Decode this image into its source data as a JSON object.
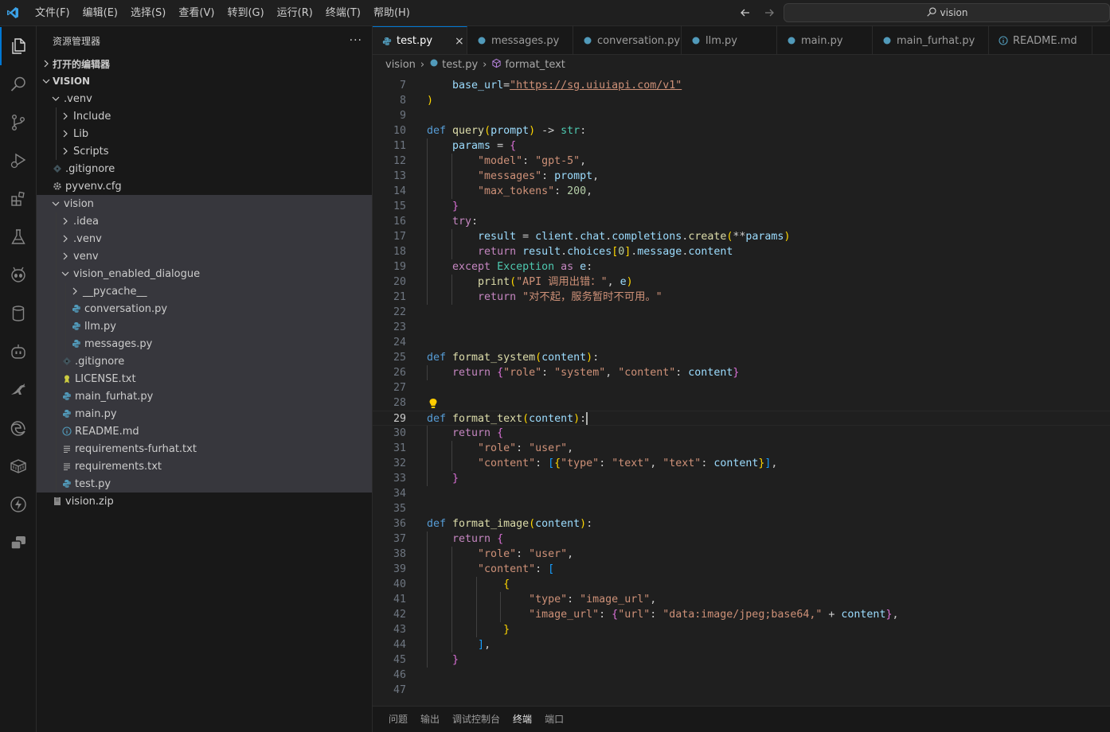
{
  "titlebar": {
    "menu": [
      "文件(F)",
      "编辑(E)",
      "选择(S)",
      "查看(V)",
      "转到(G)",
      "运行(R)",
      "终端(T)",
      "帮助(H)"
    ],
    "search_text": "vision"
  },
  "sidebar": {
    "title": "资源管理器",
    "more": "···",
    "open_editors": "打开的编辑器",
    "root": "VISION",
    "tree": [
      {
        "label": ".venv"
      },
      {
        "label": "Include"
      },
      {
        "label": "Lib"
      },
      {
        "label": "Scripts"
      },
      {
        "label": ".gitignore"
      },
      {
        "label": "pyvenv.cfg"
      },
      {
        "label": "vision"
      },
      {
        "label": ".idea"
      },
      {
        "label": ".venv"
      },
      {
        "label": "venv"
      },
      {
        "label": "vision_enabled_dialogue"
      },
      {
        "label": "__pycache__"
      },
      {
        "label": "conversation.py"
      },
      {
        "label": "llm.py"
      },
      {
        "label": "messages.py"
      },
      {
        "label": ".gitignore"
      },
      {
        "label": "LICENSE.txt"
      },
      {
        "label": "main_furhat.py"
      },
      {
        "label": "main.py"
      },
      {
        "label": "README.md"
      },
      {
        "label": "requirements-furhat.txt"
      },
      {
        "label": "requirements.txt"
      },
      {
        "label": "test.py"
      },
      {
        "label": "vision.zip"
      }
    ]
  },
  "tabs": [
    {
      "label": "test.py",
      "close": "×"
    },
    {
      "label": "messages.py"
    },
    {
      "label": "conversation.py"
    },
    {
      "label": "llm.py"
    },
    {
      "label": "main.py"
    },
    {
      "label": "main_furhat.py"
    },
    {
      "label": "README.md"
    }
  ],
  "breadcrumb": [
    "vision",
    "test.py",
    "format_text"
  ],
  "editor": {
    "lines": [
      {
        "n": "7",
        "tokens": [
          [
            "p",
            "    "
          ],
          [
            "v",
            "base_url"
          ],
          [
            "p",
            "="
          ],
          [
            "url",
            "\"https://sg.uiuiapi.com/v1\""
          ]
        ]
      },
      {
        "n": "8",
        "tokens": [
          [
            "b1",
            ")"
          ]
        ]
      },
      {
        "n": "9",
        "tokens": []
      },
      {
        "n": "10",
        "tokens": [
          [
            "k",
            "def "
          ],
          [
            "fn",
            "query"
          ],
          [
            "b1",
            "("
          ],
          [
            "v",
            "prompt"
          ],
          [
            "b1",
            ")"
          ],
          [
            "p",
            " -> "
          ],
          [
            "t",
            "str"
          ],
          [
            "p",
            ":"
          ]
        ]
      },
      {
        "n": "11",
        "tokens": [
          [
            "p",
            "    "
          ],
          [
            "v",
            "params"
          ],
          [
            "p",
            " = "
          ],
          [
            "b2",
            "{"
          ]
        ]
      },
      {
        "n": "12",
        "tokens": [
          [
            "p",
            "        "
          ],
          [
            "s",
            "\"model\""
          ],
          [
            "p",
            ": "
          ],
          [
            "s",
            "\"gpt-5\""
          ],
          [
            "p",
            ","
          ]
        ]
      },
      {
        "n": "13",
        "tokens": [
          [
            "p",
            "        "
          ],
          [
            "s",
            "\"messages\""
          ],
          [
            "p",
            ": "
          ],
          [
            "v",
            "prompt"
          ],
          [
            "p",
            ","
          ]
        ]
      },
      {
        "n": "14",
        "tokens": [
          [
            "p",
            "        "
          ],
          [
            "s",
            "\"max_tokens\""
          ],
          [
            "p",
            ": "
          ],
          [
            "n",
            "200"
          ],
          [
            "p",
            ","
          ]
        ]
      },
      {
        "n": "15",
        "tokens": [
          [
            "p",
            "    "
          ],
          [
            "b2",
            "}"
          ]
        ]
      },
      {
        "n": "16",
        "tokens": [
          [
            "p",
            "    "
          ],
          [
            "c",
            "try"
          ],
          [
            "p",
            ":"
          ]
        ]
      },
      {
        "n": "17",
        "tokens": [
          [
            "p",
            "        "
          ],
          [
            "v",
            "result"
          ],
          [
            "p",
            " = "
          ],
          [
            "v",
            "client"
          ],
          [
            "p",
            "."
          ],
          [
            "v",
            "chat"
          ],
          [
            "p",
            "."
          ],
          [
            "v",
            "completions"
          ],
          [
            "p",
            "."
          ],
          [
            "fn",
            "create"
          ],
          [
            "b1",
            "("
          ],
          [
            "p",
            "**"
          ],
          [
            "v",
            "params"
          ],
          [
            "b1",
            ")"
          ]
        ]
      },
      {
        "n": "18",
        "tokens": [
          [
            "p",
            "        "
          ],
          [
            "c",
            "return "
          ],
          [
            "v",
            "result"
          ],
          [
            "p",
            "."
          ],
          [
            "v",
            "choices"
          ],
          [
            "b1",
            "["
          ],
          [
            "n",
            "0"
          ],
          [
            "b1",
            "]"
          ],
          [
            "p",
            "."
          ],
          [
            "v",
            "message"
          ],
          [
            "p",
            "."
          ],
          [
            "v",
            "content"
          ]
        ]
      },
      {
        "n": "19",
        "tokens": [
          [
            "p",
            "    "
          ],
          [
            "c",
            "except "
          ],
          [
            "t",
            "Exception"
          ],
          [
            "c",
            " as "
          ],
          [
            "v",
            "e"
          ],
          [
            "p",
            ":"
          ]
        ]
      },
      {
        "n": "20",
        "tokens": [
          [
            "p",
            "        "
          ],
          [
            "fn",
            "print"
          ],
          [
            "b1",
            "("
          ],
          [
            "s",
            "\"API 调用出错：\""
          ],
          [
            "p",
            ", "
          ],
          [
            "v",
            "e"
          ],
          [
            "b1",
            ")"
          ]
        ]
      },
      {
        "n": "21",
        "tokens": [
          [
            "p",
            "        "
          ],
          [
            "c",
            "return "
          ],
          [
            "s",
            "\"对不起，服务暂时不可用。\""
          ]
        ]
      },
      {
        "n": "22",
        "tokens": []
      },
      {
        "n": "23",
        "tokens": []
      },
      {
        "n": "24",
        "tokens": []
      },
      {
        "n": "25",
        "tokens": [
          [
            "k",
            "def "
          ],
          [
            "fn",
            "format_system"
          ],
          [
            "b1",
            "("
          ],
          [
            "v",
            "content"
          ],
          [
            "b1",
            ")"
          ],
          [
            "p",
            ":"
          ]
        ]
      },
      {
        "n": "26",
        "tokens": [
          [
            "p",
            "    "
          ],
          [
            "c",
            "return "
          ],
          [
            "b2",
            "{"
          ],
          [
            "s",
            "\"role\""
          ],
          [
            "p",
            ": "
          ],
          [
            "s",
            "\"system\""
          ],
          [
            "p",
            ", "
          ],
          [
            "s",
            "\"content\""
          ],
          [
            "p",
            ": "
          ],
          [
            "v",
            "content"
          ],
          [
            "b2",
            "}"
          ]
        ]
      },
      {
        "n": "27",
        "tokens": []
      },
      {
        "n": "28",
        "tokens": []
      },
      {
        "n": "29",
        "tokens": [
          [
            "k",
            "def "
          ],
          [
            "fn",
            "format_text"
          ],
          [
            "b1",
            "("
          ],
          [
            "v",
            "content"
          ],
          [
            "b1",
            ")"
          ],
          [
            "p",
            ":"
          ]
        ]
      },
      {
        "n": "30",
        "tokens": [
          [
            "p",
            "    "
          ],
          [
            "c",
            "return "
          ],
          [
            "b2",
            "{"
          ]
        ]
      },
      {
        "n": "31",
        "tokens": [
          [
            "p",
            "        "
          ],
          [
            "s",
            "\"role\""
          ],
          [
            "p",
            ": "
          ],
          [
            "s",
            "\"user\""
          ],
          [
            "p",
            ","
          ]
        ]
      },
      {
        "n": "32",
        "tokens": [
          [
            "p",
            "        "
          ],
          [
            "s",
            "\"content\""
          ],
          [
            "p",
            ": "
          ],
          [
            "b3",
            "["
          ],
          [
            "b1",
            "{"
          ],
          [
            "s",
            "\"type\""
          ],
          [
            "p",
            ": "
          ],
          [
            "s",
            "\"text\""
          ],
          [
            "p",
            ", "
          ],
          [
            "s",
            "\"text\""
          ],
          [
            "p",
            ": "
          ],
          [
            "v",
            "content"
          ],
          [
            "b1",
            "}"
          ],
          [
            "b3",
            "]"
          ],
          [
            "p",
            ","
          ]
        ]
      },
      {
        "n": "33",
        "tokens": [
          [
            "p",
            "    "
          ],
          [
            "b2",
            "}"
          ]
        ]
      },
      {
        "n": "34",
        "tokens": []
      },
      {
        "n": "35",
        "tokens": []
      },
      {
        "n": "36",
        "tokens": [
          [
            "k",
            "def "
          ],
          [
            "fn",
            "format_image"
          ],
          [
            "b1",
            "("
          ],
          [
            "v",
            "content"
          ],
          [
            "b1",
            ")"
          ],
          [
            "p",
            ":"
          ]
        ]
      },
      {
        "n": "37",
        "tokens": [
          [
            "p",
            "    "
          ],
          [
            "c",
            "return "
          ],
          [
            "b2",
            "{"
          ]
        ]
      },
      {
        "n": "38",
        "tokens": [
          [
            "p",
            "        "
          ],
          [
            "s",
            "\"role\""
          ],
          [
            "p",
            ": "
          ],
          [
            "s",
            "\"user\""
          ],
          [
            "p",
            ","
          ]
        ]
      },
      {
        "n": "39",
        "tokens": [
          [
            "p",
            "        "
          ],
          [
            "s",
            "\"content\""
          ],
          [
            "p",
            ": "
          ],
          [
            "b3",
            "["
          ]
        ]
      },
      {
        "n": "40",
        "tokens": [
          [
            "p",
            "            "
          ],
          [
            "b1",
            "{"
          ]
        ]
      },
      {
        "n": "41",
        "tokens": [
          [
            "p",
            "                "
          ],
          [
            "s",
            "\"type\""
          ],
          [
            "p",
            ": "
          ],
          [
            "s",
            "\"image_url\""
          ],
          [
            "p",
            ","
          ]
        ]
      },
      {
        "n": "42",
        "tokens": [
          [
            "p",
            "                "
          ],
          [
            "s",
            "\"image_url\""
          ],
          [
            "p",
            ": "
          ],
          [
            "b2",
            "{"
          ],
          [
            "s",
            "\"url\""
          ],
          [
            "p",
            ": "
          ],
          [
            "s",
            "\"data:image/jpeg;base64,\""
          ],
          [
            "p",
            " + "
          ],
          [
            "v",
            "content"
          ],
          [
            "b2",
            "}"
          ],
          [
            "p",
            ","
          ]
        ]
      },
      {
        "n": "43",
        "tokens": [
          [
            "p",
            "            "
          ],
          [
            "b1",
            "}"
          ]
        ]
      },
      {
        "n": "44",
        "tokens": [
          [
            "p",
            "        "
          ],
          [
            "b3",
            "]"
          ],
          [
            "p",
            ","
          ]
        ]
      },
      {
        "n": "45",
        "tokens": [
          [
            "p",
            "    "
          ],
          [
            "b2",
            "}"
          ]
        ]
      },
      {
        "n": "46",
        "tokens": []
      },
      {
        "n": "47",
        "tokens": []
      }
    ]
  },
  "panel": {
    "tabs": [
      "问题",
      "输出",
      "调试控制台",
      "终端",
      "端口"
    ]
  }
}
